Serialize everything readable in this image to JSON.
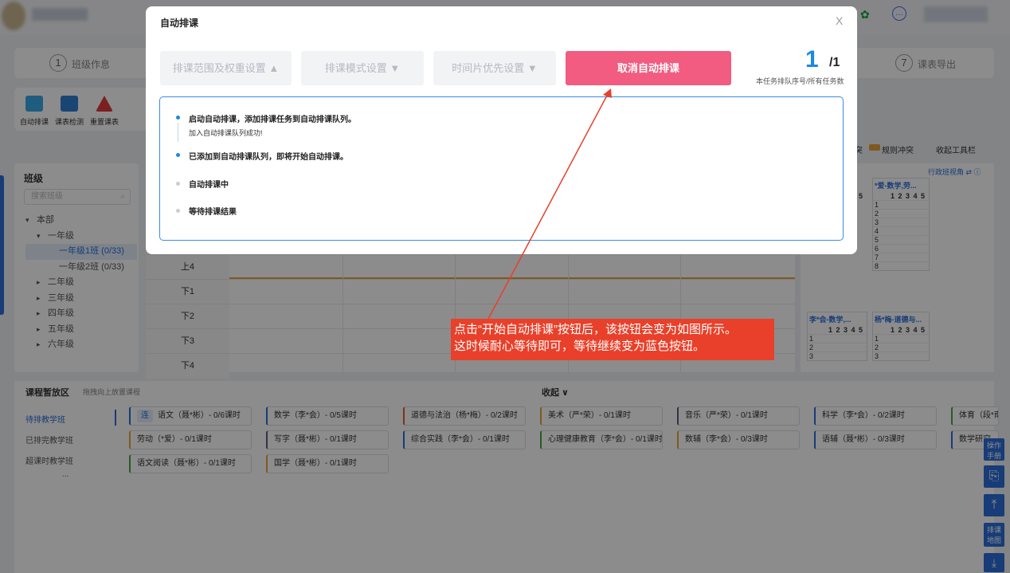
{
  "steps": [
    {
      "num": "1",
      "label": "班级作息"
    },
    {
      "num": "7",
      "label": "课表导出"
    }
  ],
  "toolbar": [
    {
      "label": "自动排课"
    },
    {
      "label": "课表检测"
    },
    {
      "label": "重置课表"
    }
  ],
  "class_panel": {
    "title": "班级",
    "search_placeholder": "搜索班级",
    "tree": [
      {
        "label": "本部",
        "level": 0,
        "arrow": "▾"
      },
      {
        "label": "一年级",
        "level": 1,
        "arrow": "▾"
      },
      {
        "label": "一年级1班 (0/33)",
        "level": 2,
        "arrow": ""
      },
      {
        "label": "一年级2班 (0/33)",
        "level": 2,
        "arrow": ""
      },
      {
        "label": "二年级",
        "level": 1,
        "arrow": "▸"
      },
      {
        "label": "三年级",
        "level": 1,
        "arrow": "▸"
      },
      {
        "label": "四年级",
        "level": 1,
        "arrow": "▸"
      },
      {
        "label": "五年级",
        "level": 1,
        "arrow": "▸"
      },
      {
        "label": "六年级",
        "level": 1,
        "arrow": "▸"
      }
    ]
  },
  "grid_rows": [
    "上4",
    "下1",
    "下2",
    "下3",
    "下4"
  ],
  "right_panel": {
    "legend_conflict": "突",
    "legend_rule": "规则冲突",
    "collapse_tools": "收起工具栏",
    "view_label": "行政班视角",
    "cards": [
      {
        "title": "*爱-数学,劳...",
        "cols": "1 2 3 4 5",
        "rows": [
          "1",
          "2",
          "3",
          "4",
          "5",
          "6",
          "7",
          "8"
        ]
      },
      {
        "title": "李*会-数学,...",
        "cols": "1 2 3 4 5",
        "rows": [
          "1",
          "2",
          "3"
        ]
      },
      {
        "title": "杨*梅-道德与...",
        "cols": "1 2 3 4 5",
        "rows": [
          "1",
          "2",
          "3"
        ]
      }
    ],
    "partial_cols": "5",
    "partial_rows": [
      "5",
      "6",
      "7",
      "8"
    ]
  },
  "bottom": {
    "title": "课程暂放区",
    "hint": "拖拽向上放置课程",
    "collapse": "收起 ∨",
    "tabs": [
      "待排教学班",
      "已排完教学班",
      "超课时教学班"
    ],
    "more": "...",
    "row1": [
      "语文（聂*彬）- 0/6课时",
      "数学（李*会）- 0/5课时",
      "道德与法治（杨*梅）- 0/2课时",
      "美术（严*荣）- 0/1课时",
      "音乐（严*荣）- 0/1课时",
      "科学（李*会）- 0/2课时",
      "体育（段*南"
    ],
    "row2": [
      "劳动（*爱）- 0/1课时",
      "写字（聂*彬）- 0/1课时",
      "综合实践（李*会）- 0/1课时",
      "心理健康教育（李*会）- 0/1课时",
      "数辅（李*会）- 0/3课时",
      "语辅（聂*彬）- 0/3课时",
      "数学研究"
    ],
    "row3": [
      "语文阅读（聂*彬）- 0/1课时",
      "国学（聂*彬）- 0/1课时"
    ],
    "lian": "连",
    "colors": [
      "#2a6dd9",
      "#2a6dd9",
      "#e0622e",
      "#e8a23a",
      "#5a6078",
      "#2a6dd9",
      "#4fa24a",
      "#e8a23a"
    ]
  },
  "side_buttons": [
    "操作手册",
    "排课地图"
  ],
  "modal": {
    "title": "自动排课",
    "close": "X",
    "dropdowns": [
      "排课范围及权重设置 ▲",
      "排课模式设置 ▼",
      "时间片优先设置 ▼"
    ],
    "cancel_button": "取消自动排课",
    "queue_num": "1",
    "queue_total": "/1",
    "queue_label": "本任务排队序号/所有任务数",
    "progress": [
      {
        "text": "启动自动排课，添加排课任务到自动排课队列。",
        "sub": "加入自动排课队列成功!",
        "state": "done"
      },
      {
        "text": "已添加到自动排课队列，即将开始自动排课。",
        "sub": "",
        "state": "done"
      },
      {
        "text": "自动排课中",
        "sub": "",
        "state": "pending"
      },
      {
        "text": "等待排课结果",
        "sub": "",
        "state": "pending"
      }
    ]
  },
  "callout": {
    "line1": "点击“开始自动排课”按钮后，该按钮会变为如图所示。",
    "line2": "这时候耐心等待即可，等待继续变为蓝色按钮。"
  },
  "colors": {
    "accent_blue": "#1e88e5",
    "cancel_pink": "#f15c80",
    "callout_red": "#e8402a",
    "panel_border": "#3b8be8"
  }
}
